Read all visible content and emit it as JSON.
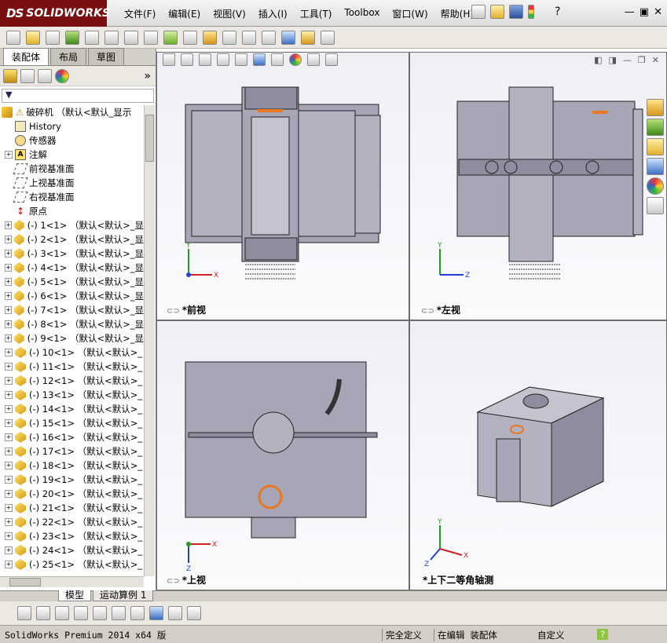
{
  "app": {
    "logo_prefix": "DS",
    "logo_text": "SOLIDWORKS",
    "menus": [
      "文件(F)",
      "编辑(E)",
      "视图(V)",
      "插入(I)",
      "工具(T)",
      "Toolbox",
      "窗口(W)",
      "帮助(H)"
    ],
    "help_icon": "?"
  },
  "left_panel": {
    "tabs": [
      "装配体",
      "布局",
      "草图"
    ],
    "active_tab": "装配体",
    "expand_arrow": "»",
    "root_label": "破碎机  （默认<默认_显示",
    "fixed_nodes": [
      {
        "label": "History",
        "icon": "history-icon"
      },
      {
        "label": "传感器",
        "icon": "sensor-icon"
      },
      {
        "label": "注解",
        "icon": "annotation-icon"
      },
      {
        "label": "前视基准面",
        "icon": "plane-icon"
      },
      {
        "label": "上视基准面",
        "icon": "plane-icon"
      },
      {
        "label": "右视基准面",
        "icon": "plane-icon"
      },
      {
        "label": "原点",
        "icon": "origin-icon"
      }
    ],
    "parts": [
      "(-) 1<1> （默认<默认>_显",
      "(-) 2<1> （默认<默认>_显",
      "(-) 3<1> （默认<默认>_显",
      "(-) 4<1> （默认<默认>_显",
      "(-) 5<1> （默认<默认>_显",
      "(-) 6<1> （默认<默认>_显",
      "(-) 7<1> （默认<默认>_显",
      "(-) 8<1> （默认<默认>_显",
      "(-) 9<1> （默认<默认>_显",
      "(-) 10<1> （默认<默认>_",
      "(-) 11<1> （默认<默认>_",
      "(-) 12<1> （默认<默认>_",
      "(-) 13<1> （默认<默认>_",
      "(-) 14<1> （默认<默认>_",
      "(-) 15<1> （默认<默认>_",
      "(-) 16<1> （默认<默认>_",
      "(-) 17<1> （默认<默认>_",
      "(-) 18<1> （默认<默认>_",
      "(-) 19<1> （默认<默认>_",
      "(-) 20<1> （默认<默认>_",
      "(-) 21<1> （默认<默认>_",
      "(-) 22<1> （默认<默认>_",
      "(-) 23<1> （默认<默认>_",
      "(-) 24<1> （默认<默认>_",
      "(-) 25<1> （默认<默认>_"
    ]
  },
  "viewports": {
    "front": "*前视",
    "left": "*左视",
    "top": "*上视",
    "iso": "*上下二等角轴测"
  },
  "axes": {
    "x": "X",
    "y": "Y",
    "z": "Z"
  },
  "bottom_tabs": [
    "模型",
    "运动算例 1"
  ],
  "status": {
    "product": "SolidWorks Premium 2014 x64 版",
    "constraint": "完全定义",
    "mode": "在编辑 装配体",
    "units": "自定义"
  },
  "colors": {
    "accent": "#7a0f0f",
    "part_fill": "#9a99a8",
    "highlight": "#e87722",
    "x_axis": "#d02020",
    "y_axis": "#20a020",
    "z_axis": "#2040d0"
  }
}
